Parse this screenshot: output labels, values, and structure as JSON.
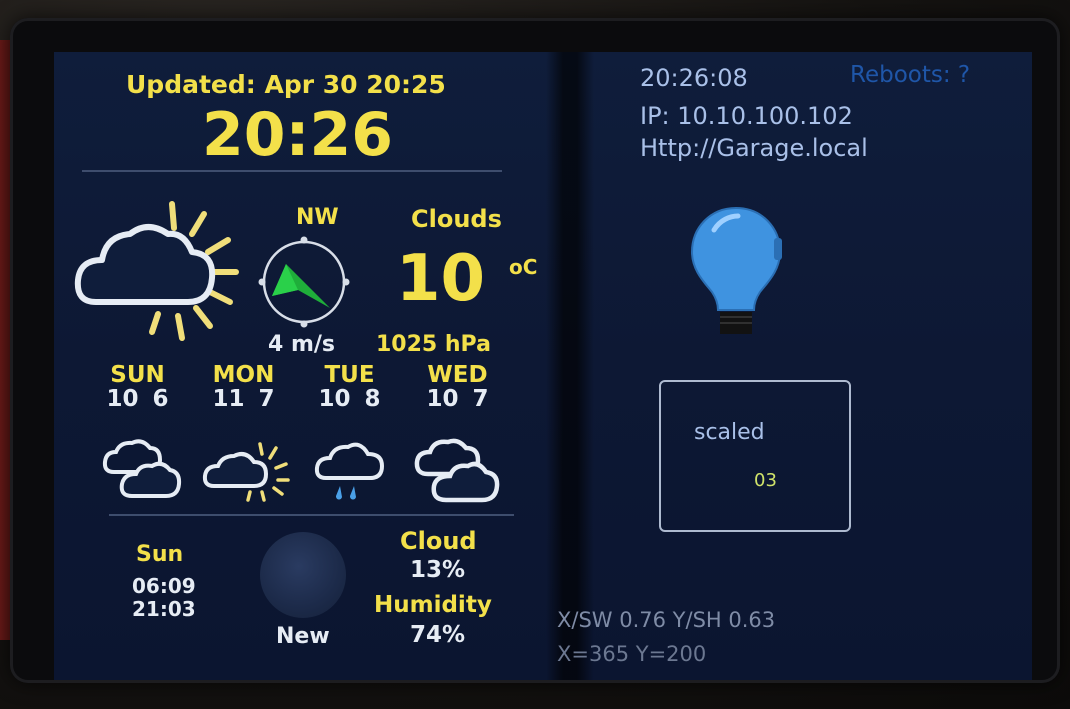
{
  "header": {
    "updated": "Updated: Apr 30 20:25",
    "clock": "20:26"
  },
  "current": {
    "icon": "cloud-sun-icon",
    "wind_direction": "NW",
    "compass_icon": "wind-compass-icon",
    "wind_speed": "4 m/s",
    "condition": "Clouds",
    "temperature": "10",
    "temperature_unit": "oC",
    "pressure": "1025 hPa"
  },
  "forecast": [
    {
      "day": "SUN",
      "temps": "10 6",
      "icon": "clouds-icon"
    },
    {
      "day": "MON",
      "temps": "11 7",
      "icon": "cloud-sun-icon"
    },
    {
      "day": "TUE",
      "temps": "10 8",
      "icon": "cloud-rain-icon"
    },
    {
      "day": "WED",
      "temps": "10 7",
      "icon": "clouds-icon"
    }
  ],
  "sun": {
    "label": "Sun",
    "sunrise": "06:09",
    "sunset": "21:03"
  },
  "moon": {
    "icon": "moon-phase-icon",
    "phase": "New"
  },
  "stats": {
    "cloud_label": "Cloud",
    "cloud_value": "13%",
    "humidity_label": "Humidity",
    "humidity_value": "74%"
  },
  "right_panel": {
    "time": "20:26:08",
    "reboot_label": "Reboots: ?",
    "ip": "IP: 10.10.100.102",
    "url": "Http://Garage.local",
    "bulb_icon": "light-bulb-icon",
    "scaled_label": "scaled",
    "scaled_value": "03",
    "sw_sh": "X/SW 0.76  Y/SH 0.63",
    "xy": "X=365       Y=200"
  },
  "colors": {
    "accent_yellow": "#f3e04a",
    "text_white": "#e6ecf4",
    "screen_bg": "#0f1d3b",
    "bulb_blue": "#3f93e0"
  }
}
